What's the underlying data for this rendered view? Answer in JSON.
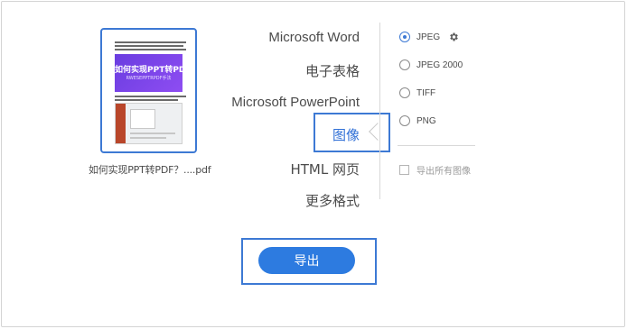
{
  "file": {
    "name": "如何实现PPT转PDF？....pdf",
    "thumbnail": {
      "banner_title": "如何实现PPT转PDF?",
      "banner_subtitle": "RWESEPPTRPDF手法"
    }
  },
  "formats": [
    {
      "label": "Microsoft Word"
    },
    {
      "label": "电子表格"
    },
    {
      "label": "Microsoft PowerPoint"
    },
    {
      "label": "图像",
      "selected": true
    },
    {
      "label": "HTML 网页"
    },
    {
      "label": "更多格式"
    }
  ],
  "image_options": {
    "types": [
      {
        "label": "JPEG",
        "checked": true,
        "settings_icon": "gear-icon"
      },
      {
        "label": "JPEG 2000",
        "checked": false
      },
      {
        "label": "TIFF",
        "checked": false
      },
      {
        "label": "PNG",
        "checked": false
      }
    ],
    "export_all_images": {
      "label": "导出所有图像",
      "checked": false,
      "enabled": false
    }
  },
  "export_button": {
    "label": "导出"
  },
  "colors": {
    "accent": "#2d7be0",
    "highlight_box": "#3d79d4",
    "selected_text": "#2f6fd6",
    "text": "#4b4b4b",
    "banner": "#7a45e8"
  }
}
